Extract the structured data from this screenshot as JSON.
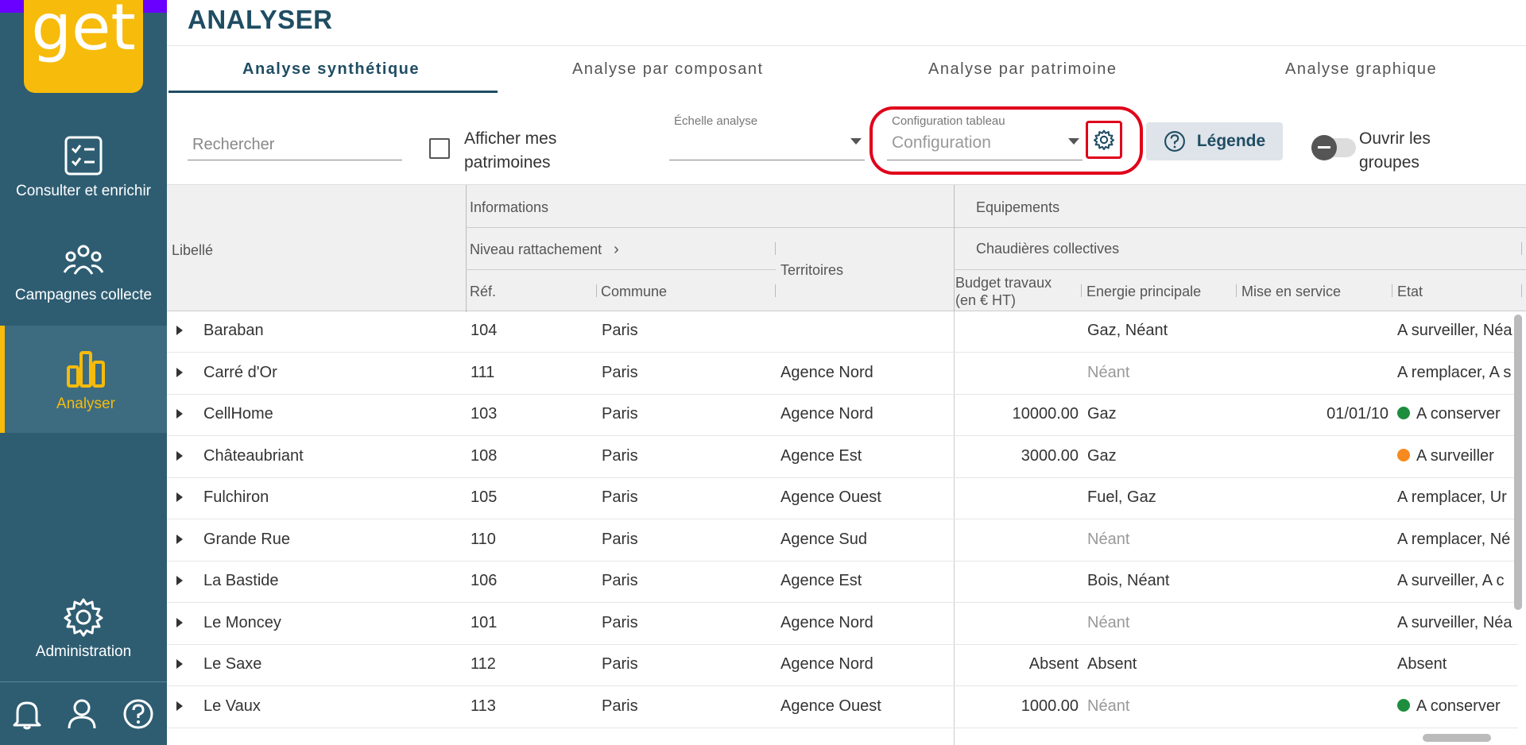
{
  "app": {
    "logo_text": "get",
    "page_title": "ANALYSER"
  },
  "sidebar": {
    "items": [
      {
        "label": "Consulter et enrichir",
        "icon": "checklist-icon",
        "active": false
      },
      {
        "label": "Campagnes collecte",
        "icon": "group-icon",
        "active": false
      },
      {
        "label": "Analyser",
        "icon": "bar-chart-icon",
        "active": true
      },
      {
        "label": "Administration",
        "icon": "gear-icon",
        "active": false
      }
    ],
    "footer_icons": [
      "bell-icon",
      "user-icon",
      "help-icon"
    ]
  },
  "tabs": [
    {
      "label": "Analyse synthétique",
      "active": true
    },
    {
      "label": "Analyse par composant",
      "active": false
    },
    {
      "label": "Analyse par patrimoine",
      "active": false
    },
    {
      "label": "Analyse graphique",
      "active": false
    }
  ],
  "toolbar": {
    "search_placeholder": "Rechercher",
    "checkbox_label": "Afficher mes patrimoines",
    "echelle_label": "Échelle analyse",
    "echelle_value": "",
    "config_label": "Configuration tableau",
    "config_placeholder": "Configuration",
    "legend_label": "Légende",
    "toggle_label": "Ouvrir les groupes"
  },
  "table": {
    "group_headers": {
      "informations": "Informations",
      "equipements": "Equipements",
      "niveau": "Niveau rattachement",
      "chaudieres": "Chaudières collectives"
    },
    "columns": {
      "libelle": "Libellé",
      "ref": "Réf.",
      "commune": "Commune",
      "territoires": "Territoires",
      "budget": "Budget travaux (en € HT)",
      "energie": "Energie principale",
      "mise": "Mise en service",
      "etat": "Etat"
    },
    "rows": [
      {
        "libelle": "Baraban",
        "ref": "104",
        "commune": "Paris",
        "territoire": "",
        "budget": "",
        "energie": "Gaz, Néant",
        "energie_muted": false,
        "mise": "",
        "etat": "A surveiller, Néa",
        "etat_dot": ""
      },
      {
        "libelle": "Carré d'Or",
        "ref": "111",
        "commune": "Paris",
        "territoire": "Agence Nord",
        "budget": "",
        "energie": "Néant",
        "energie_muted": true,
        "mise": "",
        "etat": "A remplacer, A s",
        "etat_dot": ""
      },
      {
        "libelle": "CellHome",
        "ref": "103",
        "commune": "Paris",
        "territoire": "Agence Nord",
        "budget": "10000.00",
        "energie": "Gaz",
        "energie_muted": false,
        "mise": "01/01/10",
        "etat": "A conserver",
        "etat_dot": "#1e8e3e"
      },
      {
        "libelle": "Châteaubriant",
        "ref": "108",
        "commune": "Paris",
        "territoire": "Agence Est",
        "budget": "3000.00",
        "energie": "Gaz",
        "energie_muted": false,
        "mise": "",
        "etat": "A surveiller",
        "etat_dot": "#f68a1e"
      },
      {
        "libelle": "Fulchiron",
        "ref": "105",
        "commune": "Paris",
        "territoire": "Agence Ouest",
        "budget": "",
        "energie": "Fuel, Gaz",
        "energie_muted": false,
        "mise": "",
        "etat": "A remplacer, Ur",
        "etat_dot": ""
      },
      {
        "libelle": "Grande Rue",
        "ref": "110",
        "commune": "Paris",
        "territoire": "Agence Sud",
        "budget": "",
        "energie": "Néant",
        "energie_muted": true,
        "mise": "",
        "etat": "A remplacer, Né",
        "etat_dot": ""
      },
      {
        "libelle": "La Bastide",
        "ref": "106",
        "commune": "Paris",
        "territoire": "Agence Est",
        "budget": "",
        "energie": "Bois, Néant",
        "energie_muted": false,
        "mise": "",
        "etat": "A surveiller, A c",
        "etat_dot": ""
      },
      {
        "libelle": "Le Moncey",
        "ref": "101",
        "commune": "Paris",
        "territoire": "Agence Nord",
        "budget": "",
        "energie": "Néant",
        "energie_muted": true,
        "mise": "",
        "etat": "A surveiller, Néa",
        "etat_dot": ""
      },
      {
        "libelle": "Le Saxe",
        "ref": "112",
        "commune": "Paris",
        "territoire": "Agence Nord",
        "budget": "Absent",
        "energie": "Absent",
        "energie_muted": false,
        "mise": "",
        "etat": "Absent",
        "etat_dot": ""
      },
      {
        "libelle": "Le Vaux",
        "ref": "113",
        "commune": "Paris",
        "territoire": "Agence Ouest",
        "budget": "1000.00",
        "energie": "Néant",
        "energie_muted": true,
        "mise": "",
        "etat": "A conserver",
        "etat_dot": "#1e8e3e"
      }
    ]
  }
}
